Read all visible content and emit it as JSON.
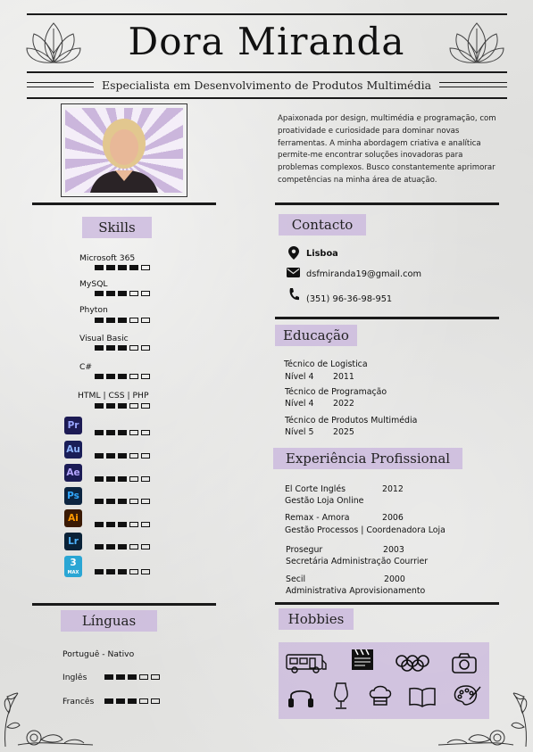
{
  "header": {
    "name": "Dora Miranda",
    "subtitle": "Especialista em Desenvolvimento de Produtos Multimédia"
  },
  "about": "Apaixonada por design, multimédia e programação, com proatividade e curiosidade para dominar novas ferramentas. A minha abordagem criativa e analítica permite-me encontrar soluções inovadoras para problemas complexos. Busco constantemente aprimorar competências na minha área de atuação.",
  "skills": {
    "heading": "Skills",
    "items": [
      {
        "label": "Microsoft 365",
        "level": 4
      },
      {
        "label": "MySQL",
        "level": 3
      },
      {
        "label": "Phyton",
        "level": 3
      },
      {
        "label": "Visual Basic",
        "level": 3
      },
      {
        "label": "C#",
        "level": 3
      },
      {
        "label": "HTML | CSS | PHP",
        "level": 3
      }
    ],
    "adobe": [
      {
        "abbr": "Pr",
        "level": 3,
        "bg": "#1d1b54",
        "fg": "#9aa6ff"
      },
      {
        "abbr": "Au",
        "level": 3,
        "bg": "#1a1e58",
        "fg": "#8fb5ff"
      },
      {
        "abbr": "Ae",
        "level": 3,
        "bg": "#1b1b55",
        "fg": "#b6a6ff"
      },
      {
        "abbr": "Ps",
        "level": 3,
        "bg": "#0c2440",
        "fg": "#31a8ff"
      },
      {
        "abbr": "Ai",
        "level": 3,
        "bg": "#3a1a05",
        "fg": "#ff9a00"
      },
      {
        "abbr": "Lr",
        "level": 3,
        "bg": "#0a2238",
        "fg": "#4fb3ff"
      },
      {
        "abbr": "3",
        "sub": "MAX",
        "level": 3,
        "bg": "#2aa6d4",
        "fg": "#ffffff"
      }
    ]
  },
  "languages": {
    "heading": "Línguas",
    "items": [
      {
        "label": "Portuguê - Nativo",
        "level": null
      },
      {
        "label": "Inglês",
        "level": 3
      },
      {
        "label": "Francês",
        "level": 3
      }
    ]
  },
  "contact": {
    "heading": "Contacto",
    "location": "Lisboa",
    "email": "dsfmiranda19@gmail.com",
    "phone": "(351) 96-36-98-951",
    "icons": [
      "location-pin-icon",
      "envelope-icon",
      "phone-icon"
    ]
  },
  "education": {
    "heading": "Educação",
    "items": [
      {
        "title": "Técnico de Logistica",
        "level": "Nível 4",
        "year": "2011"
      },
      {
        "title": "Técnico de Programação",
        "level": "Nível 4",
        "year": "2022"
      },
      {
        "title": "Técnico de Produtos Multimédia",
        "level": "Nível 5",
        "year": "2025"
      }
    ]
  },
  "experience": {
    "heading": "Experiência Profissional",
    "items": [
      {
        "company": "El Corte Inglés",
        "year": "2012",
        "role": "Gestão Loja Online"
      },
      {
        "company": "Remax - Amora",
        "year": "2006",
        "role": "Gestão Processos | Coordenadora Loja"
      },
      {
        "company": "Prosegur",
        "year": "2003",
        "role": "Secretária Administração Courrier"
      },
      {
        "company": "Secil",
        "year": "2000",
        "role": "Administrativa Aprovisionamento"
      }
    ]
  },
  "hobbies": {
    "heading": "Hobbies",
    "icons": [
      "camper-van-icon",
      "clapperboard-icon",
      "olympic-rings-icon",
      "camera-icon",
      "headphones-icon",
      "mannequin-icon",
      "chef-hat-icon",
      "open-book-icon",
      "paint-palette-icon"
    ]
  },
  "colors": {
    "accent": "#c8b4dc",
    "ink": "#1a1a1a",
    "paper": "#e2e2e0"
  }
}
